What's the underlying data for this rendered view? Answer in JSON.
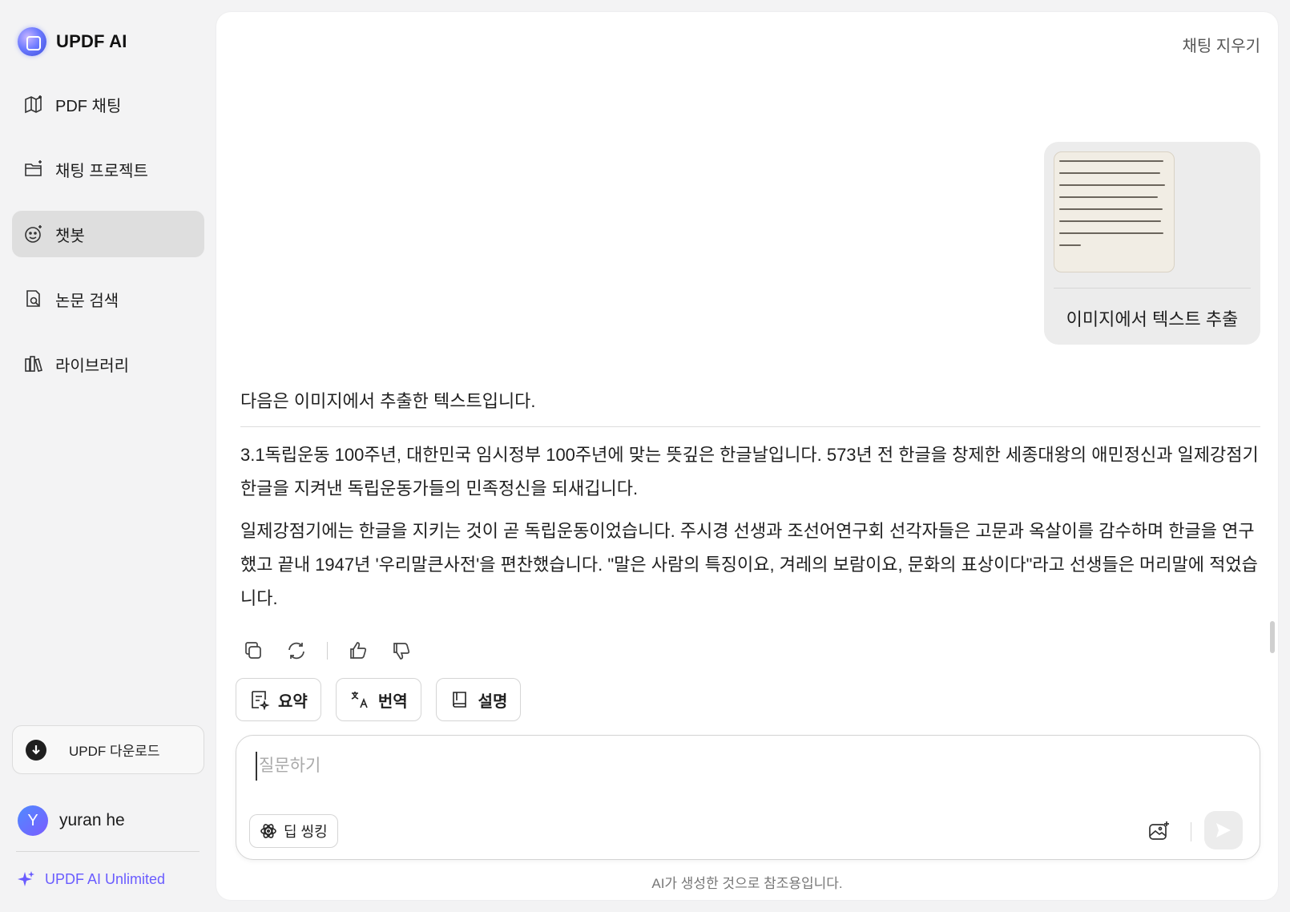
{
  "brand": {
    "name": "UPDF AI"
  },
  "nav": [
    {
      "label": "PDF 채팅",
      "icon": "book-sparkle-icon",
      "active": false
    },
    {
      "label": "채팅 프로젝트",
      "icon": "folder-sparkle-icon",
      "active": false
    },
    {
      "label": "챗봇",
      "icon": "bot-face-icon",
      "active": true
    },
    {
      "label": "논문 검색",
      "icon": "document-search-icon",
      "active": false
    },
    {
      "label": "라이브러리",
      "icon": "library-icon",
      "active": false
    }
  ],
  "sidebar": {
    "download_label": "UPDF 다운로드",
    "user": {
      "initial": "Y",
      "name": "yuran he"
    },
    "unlimited_label": "UPDF AI Unlimited"
  },
  "header": {
    "clear_chat": "채팅 지우기"
  },
  "chat": {
    "user_message": {
      "text": "이미지에서 텍스트 추출",
      "has_image": true
    },
    "response": {
      "intro": "다음은 이미지에서 추출한 텍스트입니다.",
      "paragraphs": [
        "3.1독립운동 100주년, 대한민국 임시정부 100주년에 맞는 뜻깊은 한글날입니다. 573년 전 한글을 창제한 세종대왕의 애민정신과 일제강점기 한글을 지켜낸 독립운동가들의 민족정신을 되새깁니다.",
        "일제강점기에는 한글을 지키는 것이 곧 독립운동이었습니다. 주시경 선생과 조선어연구회 선각자들은 고문과 옥살이를 감수하며 한글을 연구했고 끝내 1947년 '우리말큰사전'을 편찬했습니다. \"말은 사람의 특징이요, 겨레의 보람이요, 문화의 표상이다\"라고 선생들은 머리말에 적었습니다."
      ]
    }
  },
  "quick_actions": [
    {
      "label": "요약",
      "icon": "summary-icon"
    },
    {
      "label": "번역",
      "icon": "translate-icon"
    },
    {
      "label": "설명",
      "icon": "book-icon"
    }
  ],
  "input": {
    "placeholder": "질문하기",
    "value": "",
    "deep_thinking_label": "딥 씽킹"
  },
  "footer": {
    "disclaimer": "AI가 생성한 것으로 참조용입니다."
  },
  "colors": {
    "accent": "#6a5cff",
    "active_nav_bg": "#dedede",
    "bubble_bg": "#ececec"
  }
}
